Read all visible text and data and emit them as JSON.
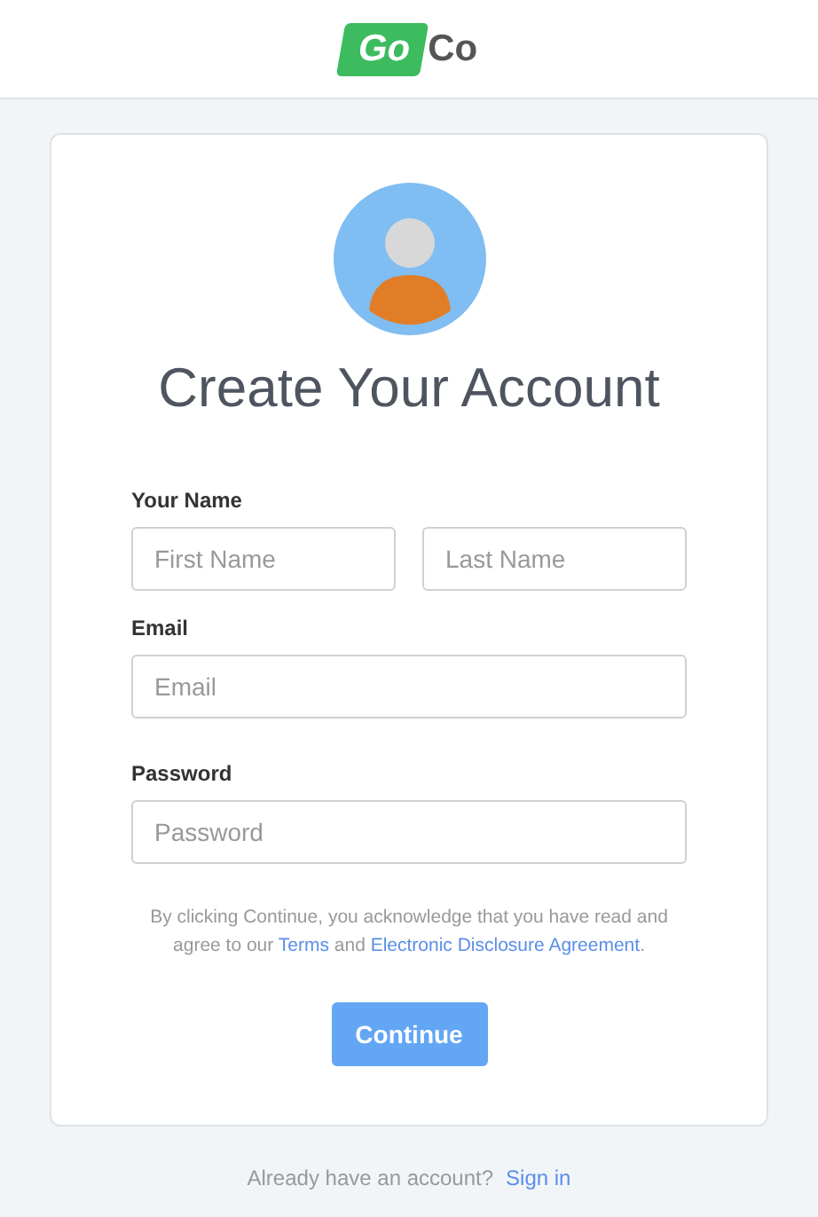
{
  "logo": {
    "badge_text": "Go",
    "text": "Co"
  },
  "title": "Create Your Account",
  "name_group": {
    "label": "Your Name",
    "fields": [
      {
        "placeholder": "First Name"
      },
      {
        "placeholder": "Last Name"
      }
    ]
  },
  "email": {
    "label": "Email",
    "placeholder": "Email"
  },
  "password": {
    "label": "Password",
    "placeholder": "Password"
  },
  "consent": {
    "before": "By clicking Continue, you acknowledge that you have read and agree to our ",
    "terms": "Terms",
    "middle": " and ",
    "agreement": "Electronic Disclosure Agreement",
    "after": "."
  },
  "continue_button": "Continue",
  "footer": {
    "text": "Already have an account?",
    "link": "Sign in"
  }
}
